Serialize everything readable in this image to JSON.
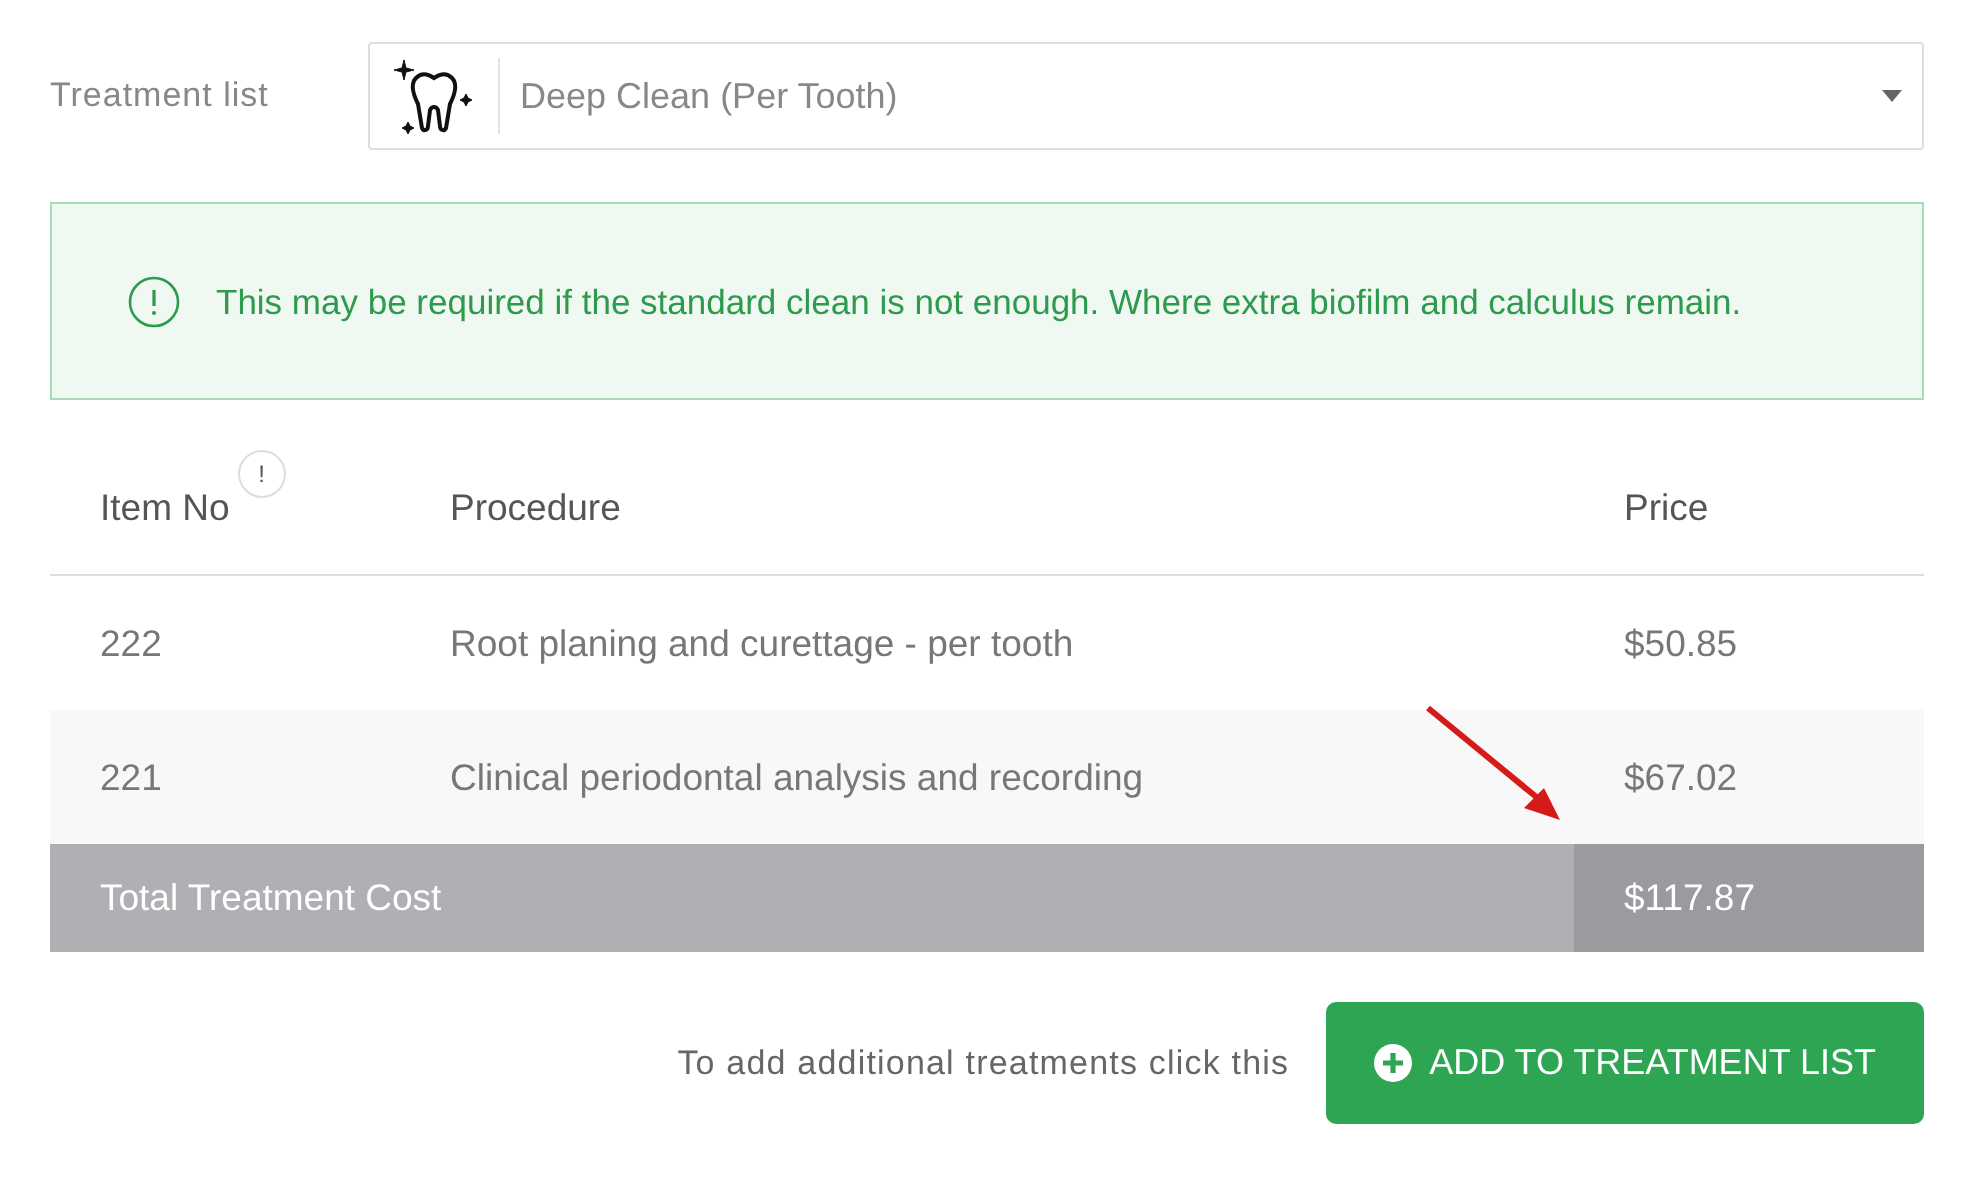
{
  "treatment_select": {
    "label": "Treatment list",
    "value": "Deep Clean (Per Tooth)"
  },
  "notice": {
    "text": "This may be required if the standard clean is not enough. Where extra biofilm and calculus remain."
  },
  "table": {
    "columns": [
      {
        "label": "Item No",
        "info": "!"
      },
      {
        "label": "Procedure"
      },
      {
        "label": "Price"
      }
    ],
    "rows": [
      {
        "item_no": "222",
        "procedure": "Root planing and curettage - per tooth",
        "price": "$50.85"
      },
      {
        "item_no": "221",
        "procedure": "Clinical periodontal analysis and recording",
        "price": "$67.02"
      }
    ],
    "total": {
      "label": "Total Treatment Cost",
      "price": "$117.87"
    }
  },
  "footer": {
    "hint": "To add additional treatments click this",
    "button": "ADD TO TREATMENT LIST"
  }
}
